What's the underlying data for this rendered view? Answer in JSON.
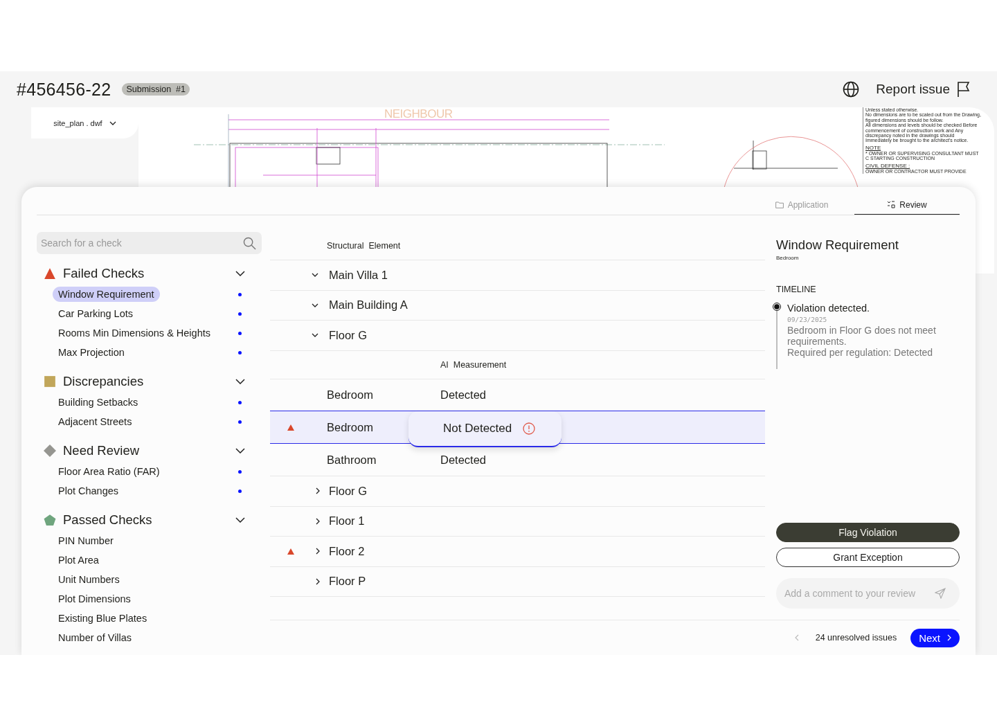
{
  "header": {
    "case_id": "#456456-22",
    "badge": "Submission  #1",
    "report_label": "Report issue"
  },
  "file_select": {
    "label": "site_plan . dwf"
  },
  "plan": {
    "title": "NEIGHBOUR",
    "notes": [
      "Unless stated otherwise.",
      "No dimensions are to be scaled out from the Drawing, figured dimensions should be follow.",
      "All dimensions and levels should be checked Before commencement of construction work and Any discrepancy noted in the drawings should Immediately be brought to the architect's notice."
    ],
    "note_heading": "NOTE",
    "note_text": "* OWNER OR SUPERVISING CONSULTANT MUST C STARTING CONSTRUCTION",
    "defense_heading": "CIVIL DEFENSE :",
    "defense_text": "OWNER OR CONTRACTOR MUST PROVIDE"
  },
  "tabs": [
    {
      "label": "Application",
      "selected": false
    },
    {
      "label": "Review",
      "selected": true
    }
  ],
  "sidebar": {
    "search": {
      "placeholder": "Search for a check"
    },
    "groups": [
      {
        "title": "Failed Checks",
        "kind": "failed",
        "color": "#d9472b",
        "expanded": true,
        "items": [
          {
            "label": "Window Requirement",
            "selected": true,
            "unresolved": true
          },
          {
            "label": "Car Parking Lots",
            "selected": false,
            "unresolved": true
          },
          {
            "label": "Rooms Min Dimensions & Heights",
            "selected": false,
            "unresolved": true
          },
          {
            "label": "Max Projection",
            "selected": false,
            "unresolved": true
          }
        ]
      },
      {
        "title": "Discrepancies",
        "kind": "discrepancy",
        "color": "#c1a65a",
        "expanded": true,
        "items": [
          {
            "label": "Building Setbacks",
            "selected": false,
            "unresolved": true
          },
          {
            "label": "Adjacent Streets",
            "selected": false,
            "unresolved": true
          }
        ]
      },
      {
        "title": "Need Review",
        "kind": "review",
        "color": "#969691",
        "expanded": true,
        "items": [
          {
            "label": "Floor Area Ratio (FAR)",
            "selected": false,
            "unresolved": true
          },
          {
            "label": "Plot Changes",
            "selected": false,
            "unresolved": true
          }
        ]
      },
      {
        "title": "Passed Checks",
        "kind": "passed",
        "color": "#6fa57e",
        "expanded": true,
        "items": [
          {
            "label": "PIN Number",
            "selected": false,
            "unresolved": false
          },
          {
            "label": "Plot Area",
            "selected": false,
            "unresolved": false
          },
          {
            "label": "Unit Numbers",
            "selected": false,
            "unresolved": false
          },
          {
            "label": "Plot Dimensions",
            "selected": false,
            "unresolved": false
          },
          {
            "label": "Existing Blue Plates",
            "selected": false,
            "unresolved": false
          },
          {
            "label": "Number of Villas",
            "selected": false,
            "unresolved": false
          }
        ]
      }
    ]
  },
  "table": {
    "heading": "Structural  Element",
    "tree": [
      {
        "label": "Main Villa 1",
        "expanded": true,
        "flagged": false,
        "children": [
          {
            "label": "Main Building A",
            "expanded": true,
            "flagged": false,
            "children": [
              {
                "label": "Floor G",
                "expanded": true,
                "flagged": false,
                "detail": {
                  "measurement_heading": "AI  Measurement",
                  "rows": [
                    {
                      "element": "Bedroom",
                      "measurement": "Detected",
                      "selected": false,
                      "flagged": false
                    },
                    {
                      "element": "Bedroom",
                      "measurement": "Not Detected",
                      "selected": true,
                      "flagged": true
                    },
                    {
                      "element": "Bathroom",
                      "measurement": "Detected",
                      "selected": false,
                      "flagged": false
                    }
                  ]
                }
              },
              {
                "label": "Floor G",
                "expanded": false,
                "flagged": false
              },
              {
                "label": "Floor 1",
                "expanded": false,
                "flagged": false
              },
              {
                "label": "Floor 2",
                "expanded": false,
                "flagged": true
              },
              {
                "label": "Floor P",
                "expanded": false,
                "flagged": false
              }
            ]
          }
        ]
      }
    ]
  },
  "detail": {
    "title": "Window Requirement",
    "subtitle": "Bedroom",
    "timeline_heading": "TIMELINE",
    "events": [
      {
        "title": "Violation detected.",
        "date": "09/23/2025",
        "description": "Bedroom in Floor G does not meet requirements.",
        "requirement": "Required per regulation: Detected"
      }
    ],
    "buttons": [
      {
        "label": "Flag Violation",
        "kind": "primary"
      },
      {
        "label": "Grant Exception",
        "kind": "outline"
      }
    ],
    "comment": {
      "placeholder": "Add a comment to your review"
    }
  },
  "pager": {
    "label": "24 unresolved issues",
    "next": "Next"
  }
}
